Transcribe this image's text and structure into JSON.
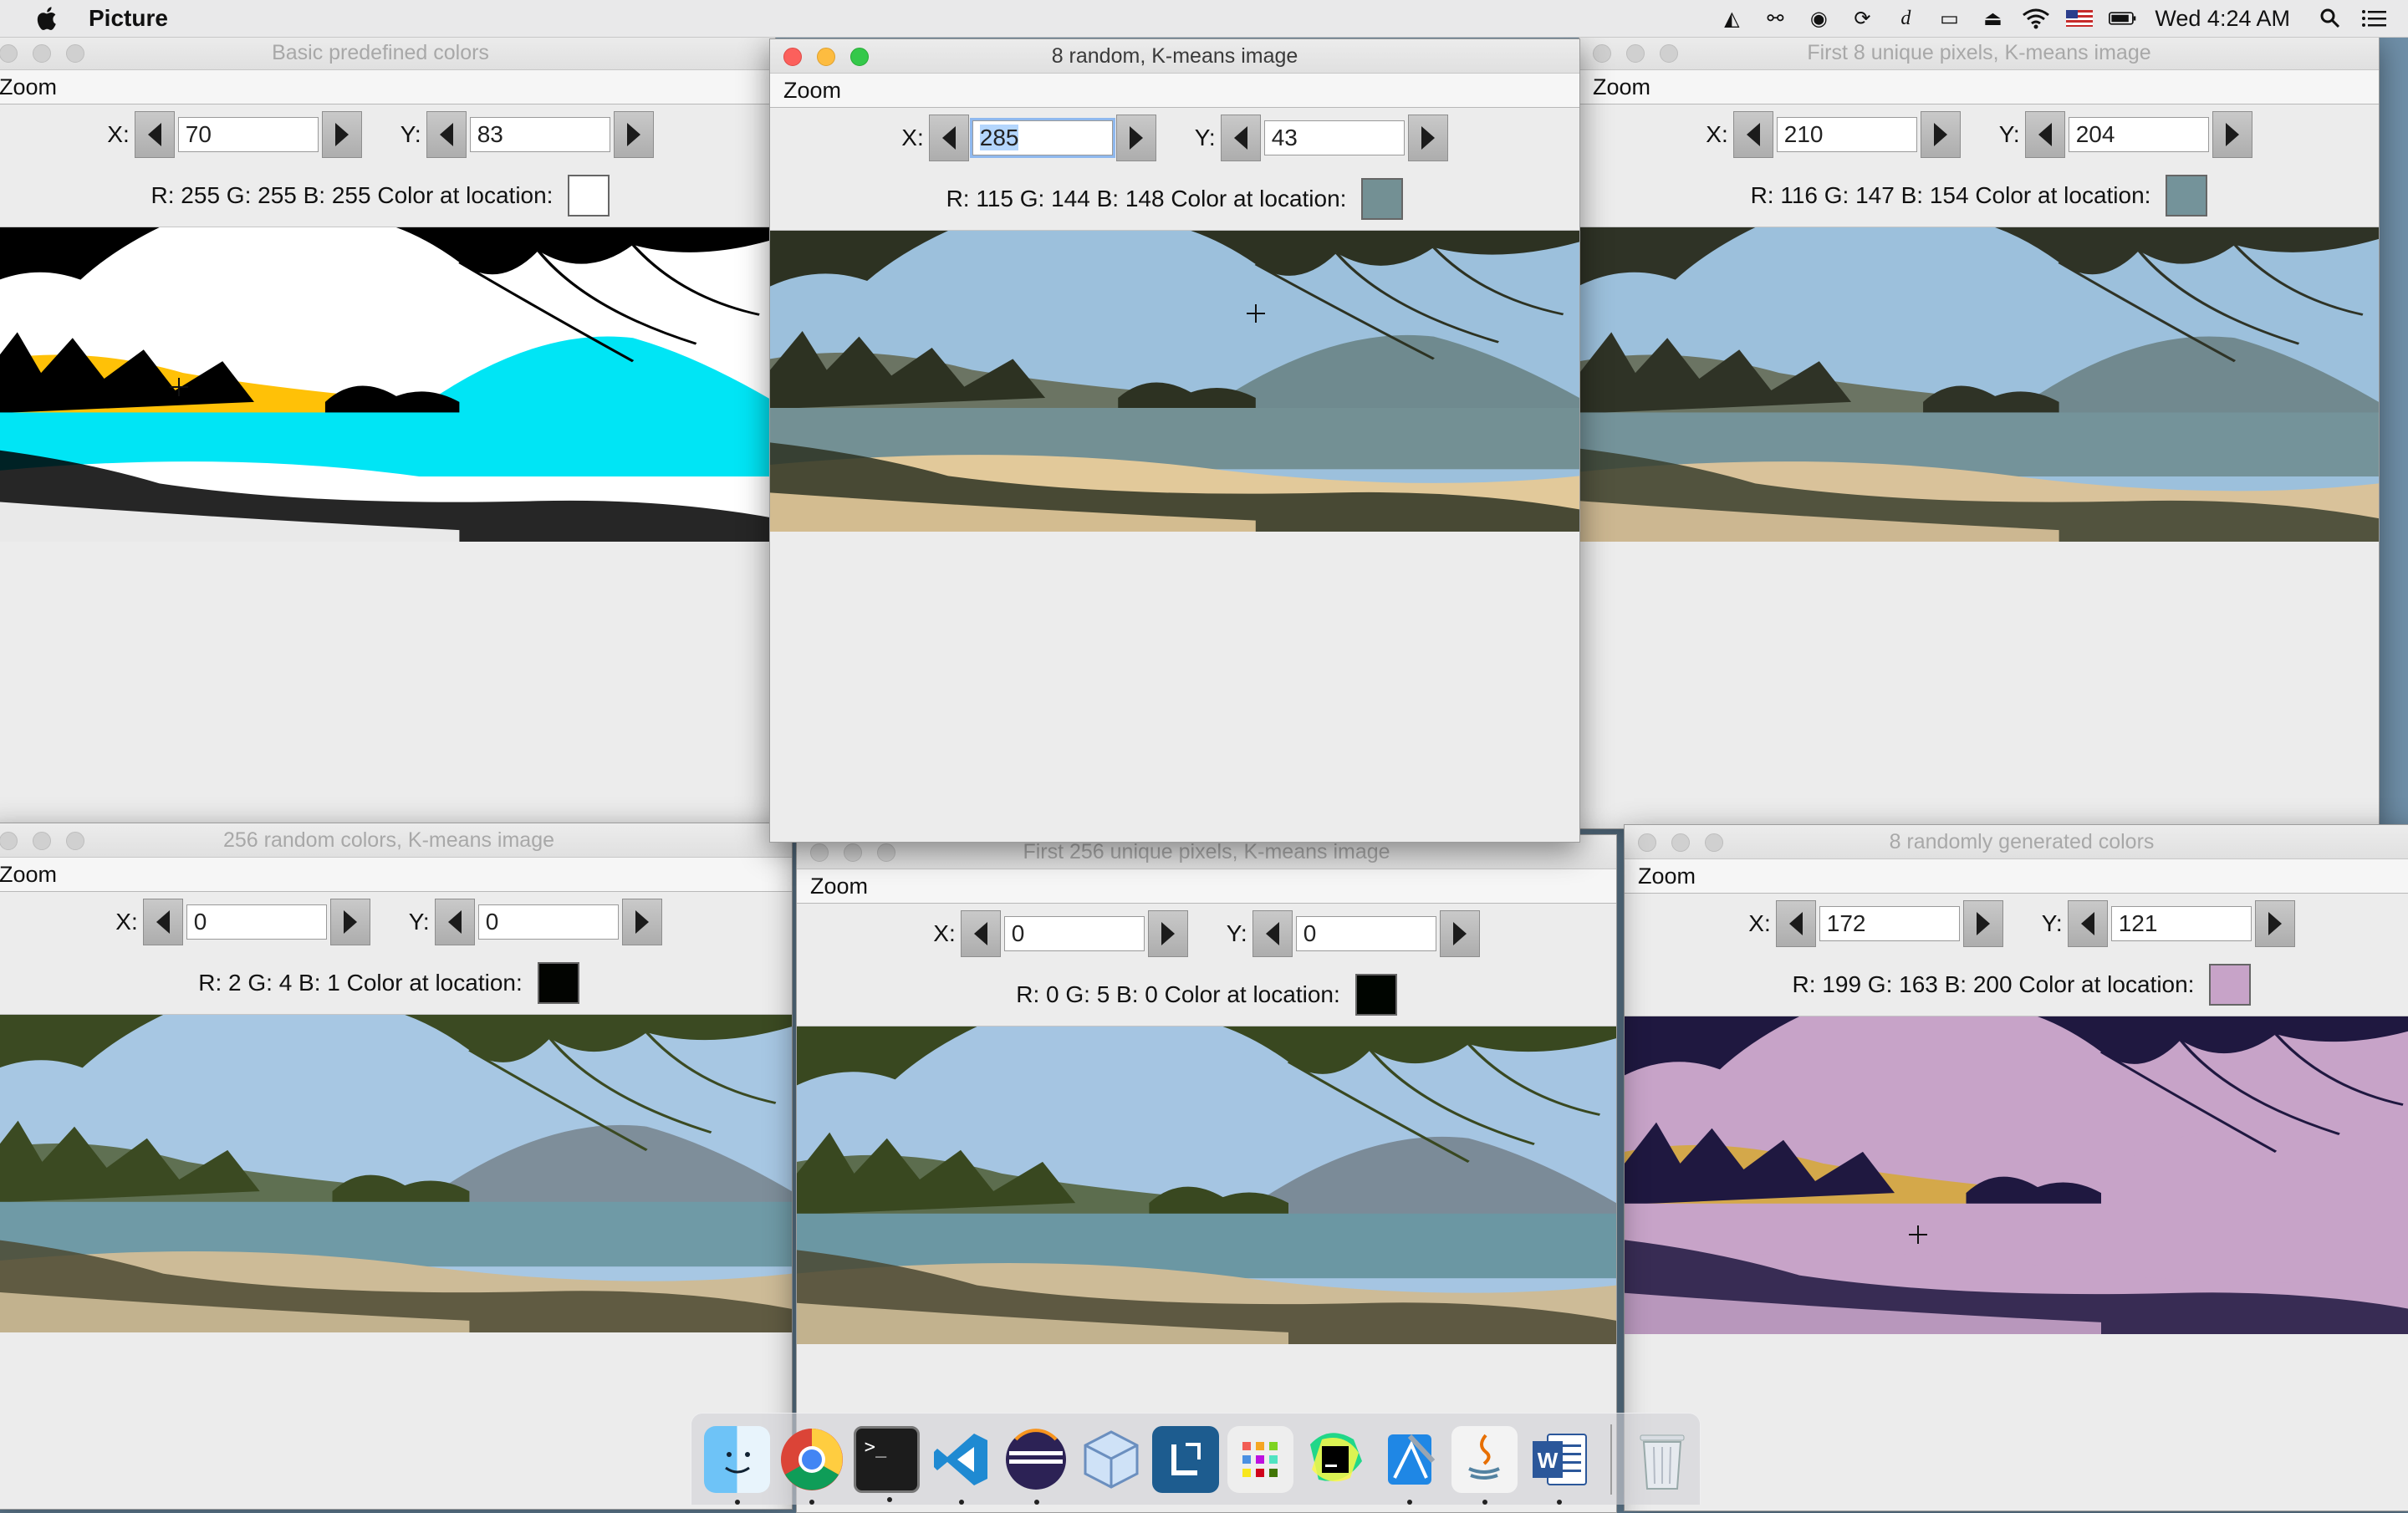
{
  "menubar": {
    "app_name": "Picture",
    "clock": "Wed 4:24 AM"
  },
  "tray_icons": [
    "adobe-icon",
    "creative-cloud-icon",
    "backup-icon",
    "sync-icon",
    "dictionary-icon",
    "airplay-icon",
    "eject-icon",
    "wifi-icon",
    "us-flag-icon",
    "battery-icon",
    "spotlight-icon",
    "notification-center-icon"
  ],
  "windows": [
    {
      "id": "basic",
      "title": "Basic predefined colors",
      "menu": "Zoom",
      "x_label": "X:",
      "x_value": "70",
      "y_label": "Y:",
      "y_value": "83",
      "rgb_text": "R: 255 G: 255 B: 255 Color at location:",
      "swatch_color": "#ffffff",
      "palette": {
        "sky": "#ffffff",
        "far": "#ffc107",
        "mountain": "#00e5f5",
        "water": "#00e5f5",
        "sand": "#ffffff",
        "shadow": "#000000",
        "foliage": "#000000"
      }
    },
    {
      "id": "random8",
      "title": "8 random, K-means image",
      "menu": "Zoom",
      "x_label": "X:",
      "x_value": "285",
      "y_label": "Y:",
      "y_value": "43",
      "rgb_text": "R: 115 G: 144 B: 148 Color at location:",
      "swatch_color": "#739094",
      "palette": {
        "sky": "#9cc0dc",
        "far": "#6b7463",
        "mountain": "#6f8a8f",
        "water": "#739094",
        "sand": "#e2c99a",
        "shadow": "#2d3222",
        "foliage": "#2d3222"
      }
    },
    {
      "id": "unique8",
      "title": "First 8 unique pixels, K-means image",
      "menu": "Zoom",
      "x_label": "X:",
      "x_value": "210",
      "y_label": "Y:",
      "y_value": "204",
      "rgb_text": "R: 116 G: 147 B: 154 Color at location:",
      "swatch_color": "#74939a",
      "palette": {
        "sky": "#9cc0dc",
        "far": "#6b7463",
        "mountain": "#71898f",
        "water": "#74939a",
        "sand": "#d9c29a",
        "shadow": "#3a3f2e",
        "foliage": "#2f3326"
      }
    },
    {
      "id": "random256",
      "title": "256 random colors, K-means image",
      "menu": "Zoom",
      "x_label": "X:",
      "x_value": "0",
      "y_label": "Y:",
      "y_value": "0",
      "rgb_text": "R: 2 G: 4 B: 1 Color at location:",
      "swatch_color": "#020401",
      "palette": {
        "sky": "#a7c7e3",
        "far": "#5f7052",
        "mountain": "#7e8e9a",
        "water": "#6f9aa6",
        "sand": "#cdbb97",
        "shadow": "#4c4a33",
        "foliage": "#3b4a22"
      }
    },
    {
      "id": "unique256",
      "title": "First 256 unique pixels, K-means image",
      "menu": "Zoom",
      "x_label": "X:",
      "x_value": "0",
      "y_label": "Y:",
      "y_value": "0",
      "rgb_text": "R: 0 G: 5 B: 0 Color at location:",
      "swatch_color": "#000500",
      "palette": {
        "sky": "#a5c5e2",
        "far": "#5c6d4e",
        "mountain": "#7b8b98",
        "water": "#6b97a3",
        "sand": "#cdbb97",
        "shadow": "#4a4832",
        "foliage": "#394820"
      }
    },
    {
      "id": "generated8",
      "title": "8 randomly generated colors",
      "menu": "Zoom",
      "x_label": "X:",
      "x_value": "172",
      "y_label": "Y:",
      "y_value": "121",
      "rgb_text": "R: 199 G: 163 B: 200 Color at location:",
      "swatch_color": "#c7a3c8",
      "palette": {
        "sky": "#c7a3c8",
        "far": "#d4a84a",
        "mountain": "#c7a3c8",
        "water": "#c7a3c8",
        "sand": "#c7a3c8",
        "shadow": "#1f1840",
        "foliage": "#1f1840"
      }
    }
  ],
  "dock": [
    "finder-icon",
    "chrome-icon",
    "terminal-icon",
    "vscode-icon",
    "eclipse-icon",
    "virtualbox-icon",
    "lasso-icon",
    "launchpad-icon",
    "pycharm-icon",
    "xcode-icon",
    "java-icon",
    "word-icon",
    "trash-icon"
  ]
}
